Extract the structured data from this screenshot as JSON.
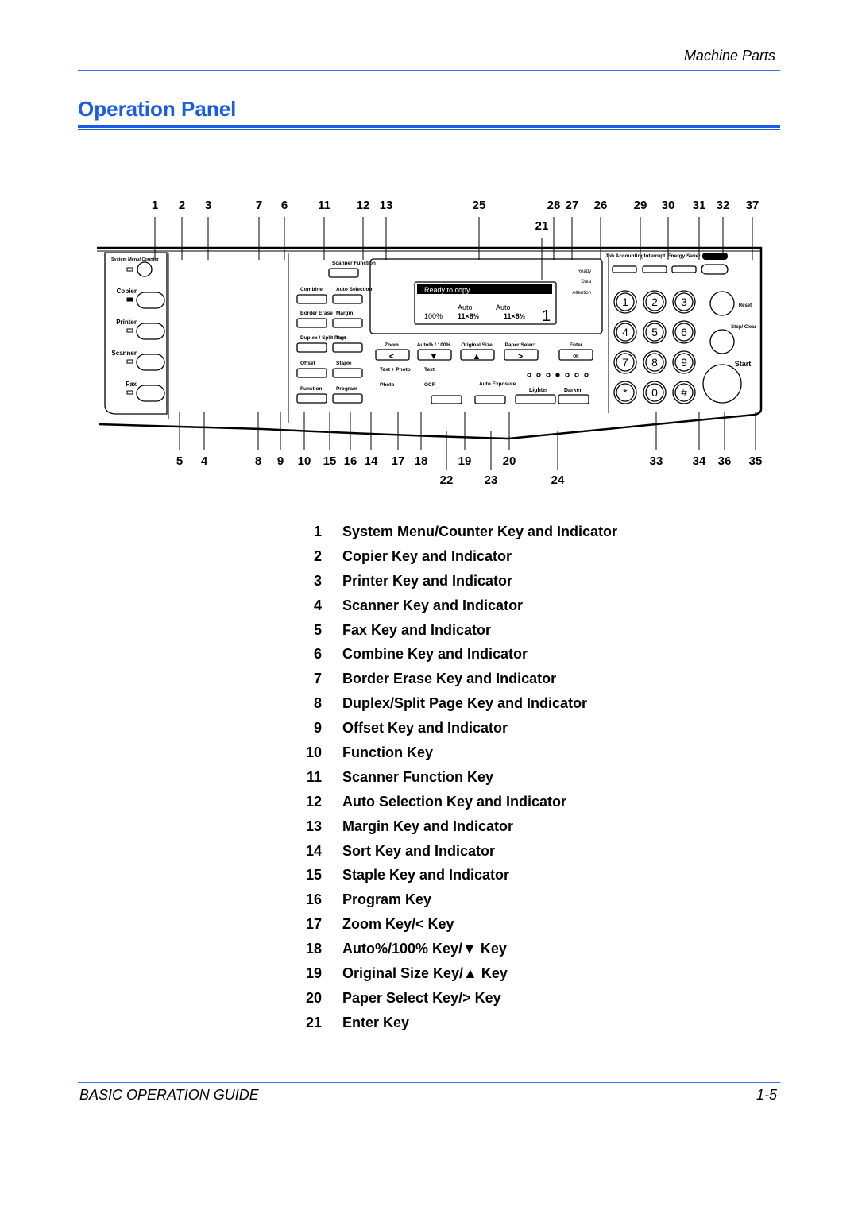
{
  "header": {
    "section": "Machine Parts"
  },
  "title": "Operation Panel",
  "diagram": {
    "callouts_top": [
      "1",
      "2",
      "3",
      "7",
      "6",
      "11",
      "12",
      "13",
      "25",
      "28",
      "27",
      "26",
      "29",
      "30",
      "31",
      "32",
      "37",
      "21"
    ],
    "callouts_bottom": [
      "5",
      "4",
      "8",
      "9",
      "10",
      "15",
      "16",
      "14",
      "17",
      "18",
      "19",
      "20",
      "33",
      "34",
      "36",
      "35",
      "22",
      "23",
      "24"
    ],
    "panel": {
      "system_menu": "System Menu/ Counter",
      "copier": "Copier",
      "printer": "Printer",
      "scanner": "Scanner",
      "fax": "Fax",
      "scanner_function": "Scanner Function",
      "combine": "Combine",
      "auto_selection": "Auto Selection",
      "border_erase": "Border Erase",
      "margin": "Margin",
      "duplex": "Duplex / Split Page",
      "sort": "Sort",
      "offset": "Offset",
      "staple": "Staple",
      "function": "Function",
      "program": "Program",
      "display_message": "Ready to copy.",
      "display_zoom": "100%",
      "display_auto1": "Auto",
      "display_auto2": "Auto",
      "display_size1": "11×8½",
      "display_size2": "11×8½",
      "display_count": "1",
      "ready": "Ready",
      "data": "Data",
      "attention": "Attention",
      "zoom": "Zoom",
      "auto100": "Auto% / 100%",
      "original_size": "Original Size",
      "paper_select": "Paper Select",
      "enter": "Enter",
      "ok": "OK",
      "text_photo": "Text + Photo",
      "photo": "Photo",
      "text": "Text",
      "ocr": "OCR",
      "auto_exposure": "Auto Exposure",
      "lighter": "Lighter",
      "darker": "Darker",
      "job_accounting": "Job Accounting",
      "interrupt": "Interrupt",
      "energy_saver": "Energy Saver",
      "power": "Power",
      "keys": [
        "1",
        "2",
        "3",
        "4",
        "5",
        "6",
        "7",
        "8",
        "9",
        "*",
        "0",
        "#"
      ],
      "reset": "Reset",
      "stop_clear": "Stop/ Clear",
      "start": "Start"
    }
  },
  "parts": [
    {
      "n": "1",
      "label": "System Menu/Counter Key and Indicator"
    },
    {
      "n": "2",
      "label": "Copier Key and Indicator"
    },
    {
      "n": "3",
      "label": "Printer Key and Indicator"
    },
    {
      "n": "4",
      "label": "Scanner Key and Indicator"
    },
    {
      "n": "5",
      "label": "Fax Key and Indicator"
    },
    {
      "n": "6",
      "label": "Combine Key and Indicator"
    },
    {
      "n": "7",
      "label": "Border Erase Key and Indicator"
    },
    {
      "n": "8",
      "label": "Duplex/Split Page Key and Indicator"
    },
    {
      "n": "9",
      "label": "Offset Key and Indicator"
    },
    {
      "n": "10",
      "label": "Function Key"
    },
    {
      "n": "11",
      "label": "Scanner Function Key"
    },
    {
      "n": "12",
      "label": "Auto Selection Key and Indicator"
    },
    {
      "n": "13",
      "label": "Margin Key and Indicator"
    },
    {
      "n": "14",
      "label": "Sort Key and Indicator"
    },
    {
      "n": "15",
      "label": "Staple Key and Indicator"
    },
    {
      "n": "16",
      "label": "Program Key"
    },
    {
      "n": "17",
      "label": "Zoom Key/< Key"
    },
    {
      "n": "18",
      "label": "Auto%/100% Key/▼ Key"
    },
    {
      "n": "19",
      "label": "Original Size Key/▲ Key"
    },
    {
      "n": "20",
      "label": "Paper Select Key/> Key"
    },
    {
      "n": "21",
      "label": "Enter Key"
    }
  ],
  "footer": {
    "left": "BASIC OPERATION GUIDE",
    "right": "1-5"
  },
  "colors": {
    "accent": "#1a5ce6"
  }
}
